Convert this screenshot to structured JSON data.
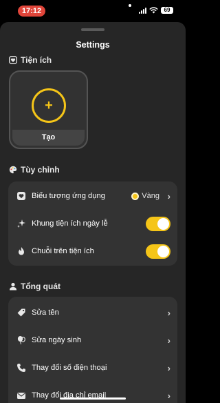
{
  "status_bar": {
    "time": "17:12",
    "battery": "69"
  },
  "sheet": {
    "title": "Settings"
  },
  "widgets_section": {
    "heading": "Tiện ích",
    "create_tile_label": "Tạo"
  },
  "customize_section": {
    "heading": "Tùy chỉnh",
    "rows": [
      {
        "label": "Biểu tượng ứng dụng",
        "value": "Vàng",
        "icon": "app-icon"
      },
      {
        "label": "Khung tiện ích ngày lễ",
        "toggle": true,
        "icon": "sparkle-icon"
      },
      {
        "label": "Chuỗi trên tiện ích",
        "toggle": true,
        "icon": "flame-icon"
      }
    ]
  },
  "general_section": {
    "heading": "Tổng quát",
    "rows": [
      {
        "label": "Sửa tên",
        "icon": "tag-icon"
      },
      {
        "label": "Sửa ngày sinh",
        "icon": "balloon-icon"
      },
      {
        "label": "Thay đổi số điện thoại",
        "icon": "phone-icon"
      },
      {
        "label": "Thay đổi địa chỉ email",
        "icon": "mail-icon"
      }
    ]
  },
  "colors": {
    "accent": "#f5c518",
    "sheet_bg": "#262626",
    "card_bg": "#333333",
    "time_pill": "#e0453a"
  }
}
